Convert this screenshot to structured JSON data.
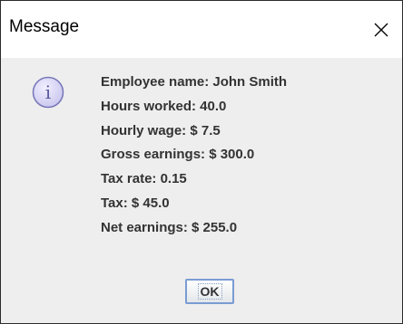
{
  "window": {
    "title": "Message",
    "close_icon": "close-icon"
  },
  "dialog": {
    "icon": "info-icon",
    "icon_glyph": "i",
    "lines": [
      "Employee name: John Smith",
      "Hours worked: 40.0",
      "Hourly wage: $ 7.5",
      "Gross earnings: $ 300.0",
      "Tax rate: 0.15",
      "Tax: $ 45.0",
      "Net earnings: $ 255.0"
    ],
    "ok_label": "OK"
  },
  "colors": {
    "dialog_background": "#eeeeee",
    "titlebar_background": "#ffffff",
    "text": "#333333",
    "button_border": "#7a9cd3",
    "icon_fill": "#d7d4f2",
    "icon_stroke": "#7676b8"
  }
}
